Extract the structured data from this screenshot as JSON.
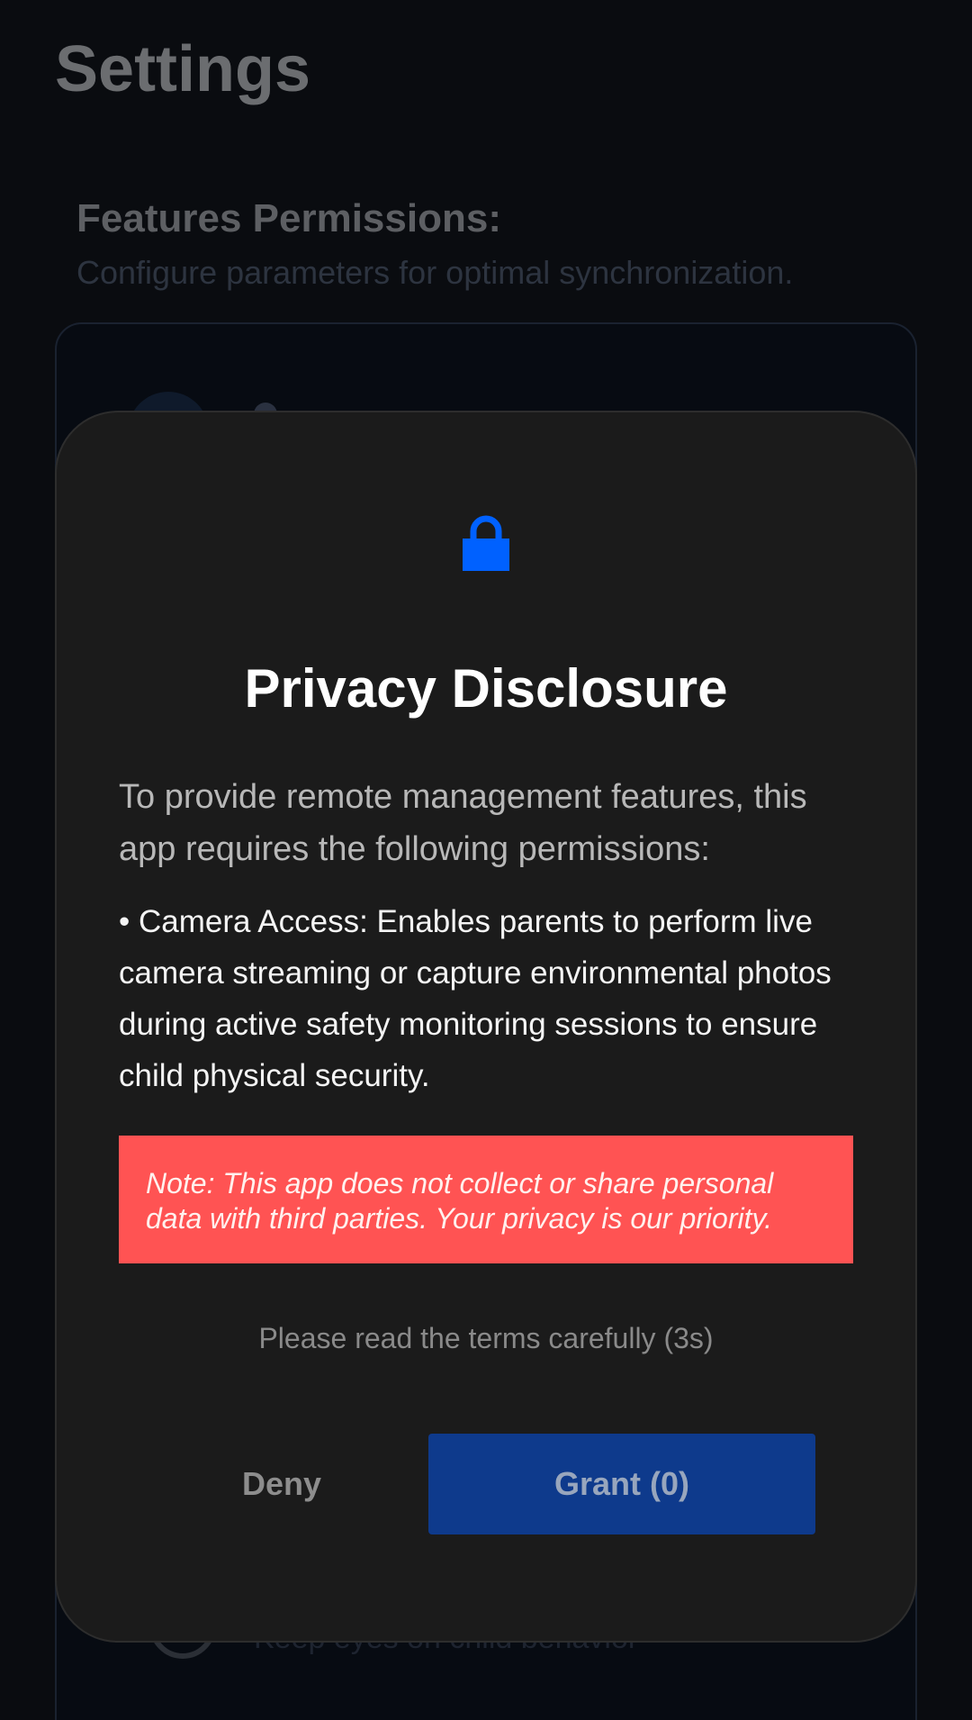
{
  "settings": {
    "title": "Settings",
    "section_title": "Features Permissions:",
    "section_subtitle": "Configure parameters for optimal synchronization.",
    "partial_row_text": "Keep eyes on child behavioi"
  },
  "dialog": {
    "icon": "lock-icon",
    "accent_color": "#0061ff",
    "title": "Privacy Disclosure",
    "intro": "To provide remote management features, this app requires the following permissions:",
    "permission": "• Camera Access: Enables parents to perform live camera streaming or capture environmental photos during active safety monitoring sessions to ensure child physical security.",
    "note": "Note: This app does not collect or share personal data with third parties. Your privacy is our priority.",
    "note_color": "#ff5353",
    "timer": "Please read the terms carefully (3s)",
    "deny_label": "Deny",
    "grant_label": "Grant (0)",
    "grant_color": "#0e3a8c"
  }
}
